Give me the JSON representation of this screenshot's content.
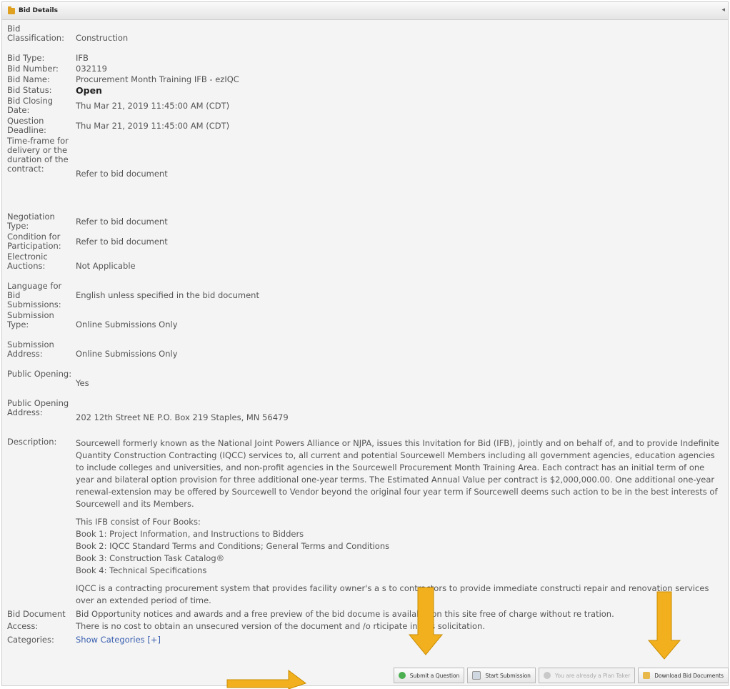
{
  "panel": {
    "title": "Bid Details",
    "collapse_glyph": "◂"
  },
  "fields": [
    {
      "label": "Bid Classification:",
      "value": "Construction"
    },
    {
      "label": "Bid Type:",
      "value": "IFB"
    },
    {
      "label": "Bid Number:",
      "value": "032119"
    },
    {
      "label": "Bid Name:",
      "value": "Procurement Month Training IFB - ezIQC"
    },
    {
      "label": "Bid Status:",
      "value": "Open"
    },
    {
      "label": "Bid Closing Date:",
      "value": "Thu Mar 21, 2019 11:45:00 AM (CDT)"
    },
    {
      "label": "Question Deadline:",
      "value": "Thu Mar 21, 2019 11:45:00 AM (CDT)"
    },
    {
      "label": "Time-frame for delivery or the duration of the contract:",
      "value": "Refer to bid document"
    },
    {
      "label": "Negotiation Type:",
      "value": "Refer to bid document"
    },
    {
      "label": "Condition for Participation:",
      "value": "Refer to bid document"
    },
    {
      "label": "Electronic Auctions:",
      "value": "Not Applicable"
    },
    {
      "label": "Language for Bid Submissions:",
      "value": "English unless specified in the bid document"
    },
    {
      "label": "Submission Type:",
      "value": "Online Submissions Only"
    },
    {
      "label": "Submission Address:",
      "value": "Online Submissions Only"
    },
    {
      "label": "Public Opening:",
      "value": "Yes"
    },
    {
      "label": "Public Opening Address:",
      "value": "202 12th Street NE P.O. Box 219 Staples, MN 56479"
    }
  ],
  "description": {
    "label": "Description:",
    "para1": "Sourcewell formerly known as the National Joint Powers Alliance or NJPA, issues this Invitation for Bid (IFB), jointly and on behalf of, and to provide Indefinite Quantity Construction Contracting (IQCC) services to, all current and potential Sourcewell Members including all government agencies, education agencies to include colleges and universities, and non-profit agencies in the Sourcewell Procurement Month Training Area. Each contract has an initial term of one year and bilateral option provision for three additional one-year terms. The Estimated Annual Value per contract is $2,000,000.00. One additional one-year renewal-extension may be offered by Sourcewell to Vendor beyond the original four year term if Sourcewell deems such action to be in the best interests of Sourcewell and its Members.",
    "books_intro": "This IFB consist of Four Books:",
    "books": [
      "Book 1:  Project Information, and Instructions to Bidders",
      "Book 2:  IQCC Standard Terms and Conditions; General Terms and Conditions",
      "Book 3:  Construction Task Catalog®",
      "Book 4:  Technical Specifications"
    ],
    "para3": "IQCC is a contracting procurement system that provides facility owner's a     s to contractors to provide immediate constructi      repair and renovation services over an extended period of time."
  },
  "access": {
    "label": "Bid Document Access:",
    "line1": "Bid Opportunity notices and awards and a free preview of the bid docume     is available on this site free of charge without re     tration.",
    "line2": "There is no cost to obtain an unsecured version of the document and /o     rticipate in this solicitation."
  },
  "categories": {
    "label": "Categories:",
    "link": "Show Categories [+]"
  },
  "buttons": {
    "question": "Submit a Question",
    "start": "Start Submission",
    "plan": "You are already a Plan Taker",
    "download": "Download Bid Documents"
  },
  "colors": {
    "arrow": "#f2b01e",
    "link": "#3a5fb0",
    "panel_bg": "#f4f4f4"
  }
}
